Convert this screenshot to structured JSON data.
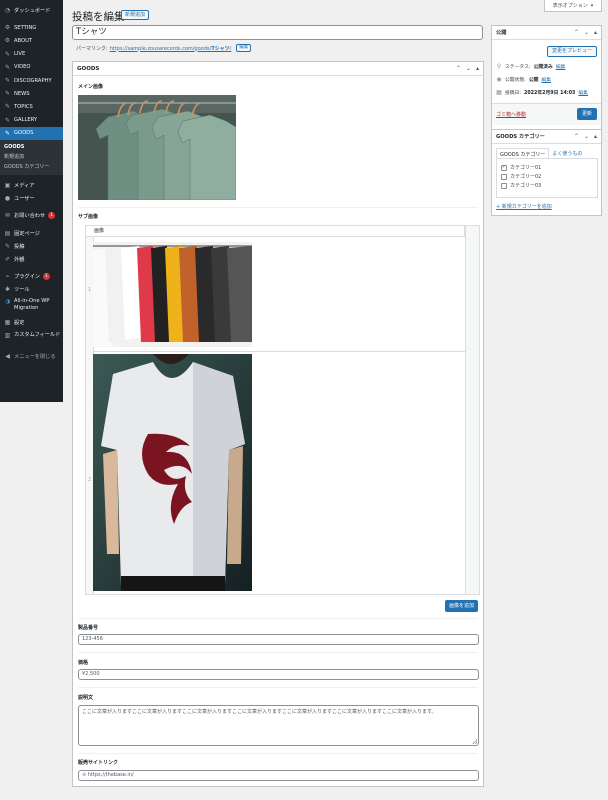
{
  "sidebar": {
    "items": [
      {
        "label": "ダッシュボード",
        "icon": "dashboard-icon"
      },
      {
        "label": "SETTING",
        "icon": "gear-icon"
      },
      {
        "label": "ABOUT",
        "icon": "gear-icon"
      },
      {
        "label": "LIVE",
        "icon": "pin-icon"
      },
      {
        "label": "VIDEO",
        "icon": "pin-icon"
      },
      {
        "label": "DISCOGRAPHY",
        "icon": "pin-icon"
      },
      {
        "label": "NEWS",
        "icon": "pin-icon"
      },
      {
        "label": "TOPICS",
        "icon": "pin-icon"
      },
      {
        "label": "GALLERY",
        "icon": "pin-icon"
      },
      {
        "label": "GOODS",
        "icon": "pin-icon"
      }
    ],
    "goods_sub": [
      "GOODS",
      "新規追加",
      "GOODS カテゴリー"
    ],
    "items2": [
      {
        "label": "メディア",
        "icon": "media-icon"
      },
      {
        "label": "ユーザー",
        "icon": "user-icon"
      },
      {
        "label": "お問い合わせ",
        "icon": "mail-icon",
        "badge": "1"
      },
      {
        "label": "固定ページ",
        "icon": "page-icon"
      },
      {
        "label": "投稿",
        "icon": "pin-icon"
      },
      {
        "label": "外観",
        "icon": "brush-icon"
      },
      {
        "label": "プラグイン",
        "icon": "plugin-icon",
        "badge": "1"
      },
      {
        "label": "ツール",
        "icon": "wrench-icon"
      },
      {
        "label": "All-in-One WP Migration",
        "icon": "migration-icon"
      },
      {
        "label": "設定",
        "icon": "settings-icon"
      },
      {
        "label": "カスタムフィールド",
        "icon": "fields-icon"
      },
      {
        "label": "メニューを閉じる",
        "icon": "collapse-icon"
      }
    ]
  },
  "screen_options": "表示オプション",
  "header": {
    "title": "投稿を編集",
    "add_new": "新規追加"
  },
  "post": {
    "title": "Tシャツ",
    "permalink_label": "パーマリンク:",
    "permalink_url": "https://sample.zousarecords.com/goods/",
    "permalink_slug": "Tシャツ",
    "permalink_end": "/",
    "edit": "編集"
  },
  "goods_box": {
    "title": "GOODS",
    "main_image_label": "メイン画像",
    "sub_image_label": "サブ画像",
    "col_header": "画像",
    "add_row": "画像を追加",
    "product_no_label": "製品番号",
    "product_no": "123-456",
    "price_label": "価格",
    "price": "¥2,500",
    "desc_label": "説明文",
    "desc": "ここに文章が入りますここに文章が入りますここに文章が入りますここに文章が入りますここに文章が入りますここに文章が入りますここに文章が入ります。",
    "shop_label": "販売サイトリンク",
    "shop_url": "https://thebase.in/"
  },
  "publish": {
    "title": "公開",
    "preview": "変更をプレビュー",
    "status_label": "ステータス:",
    "status": "公開済み",
    "visibility_label": "公開状態:",
    "visibility": "公開",
    "date_label": "投稿日:",
    "date": "2022年2月9日 14:03",
    "edit": "編集",
    "trash": "ゴミ箱へ移動",
    "update": "更新"
  },
  "category": {
    "title": "GOODS カテゴリー",
    "tab_all": "GOODS カテゴリー",
    "tab_popular": "よく使うもの",
    "items": [
      {
        "label": "カテゴリー01",
        "checked": true
      },
      {
        "label": "カテゴリー02",
        "checked": false
      },
      {
        "label": "カテゴリー03",
        "checked": false
      }
    ],
    "add_new": "+ 新規カテゴリーを追加"
  },
  "colors": {
    "accent": "#2271b1",
    "sidebar": "#1d2327",
    "danger": "#d63638"
  }
}
